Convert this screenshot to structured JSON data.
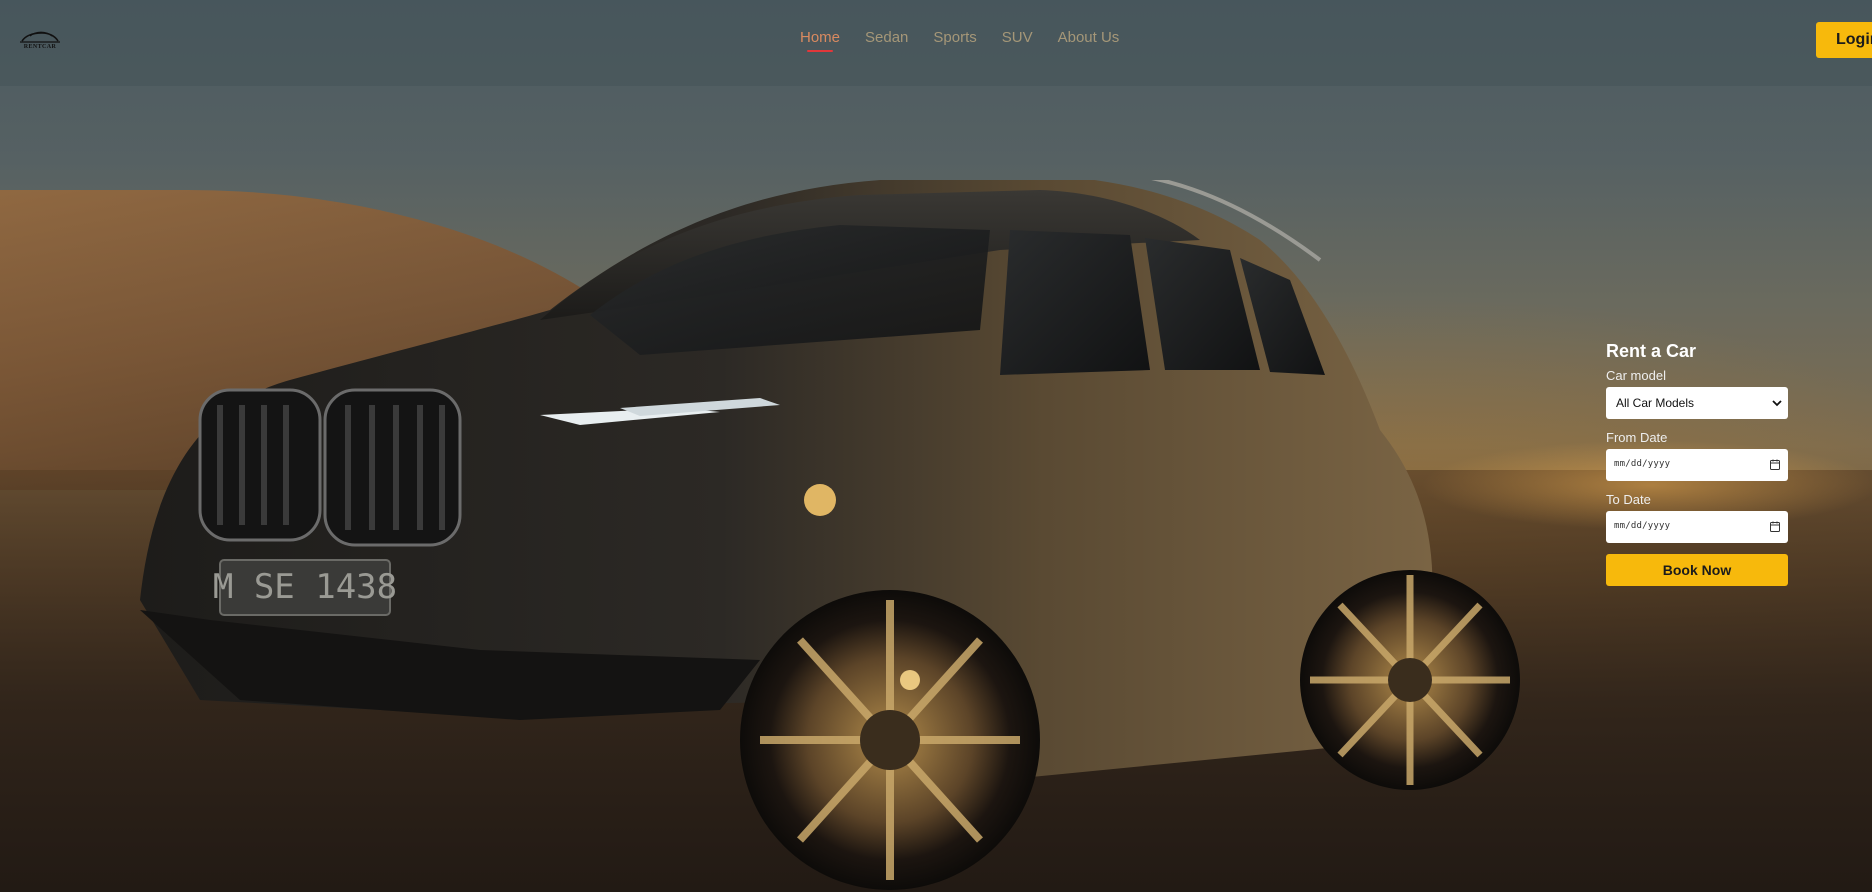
{
  "brand": {
    "logo_text": "RENTCAR"
  },
  "nav": {
    "items": [
      {
        "label": "Home",
        "active": true
      },
      {
        "label": "Sedan",
        "active": false
      },
      {
        "label": "Sports",
        "active": false
      },
      {
        "label": "SUV",
        "active": false
      },
      {
        "label": "About Us",
        "active": false
      }
    ]
  },
  "header": {
    "login_label": "Login"
  },
  "hero": {
    "plate_text": "M SE 1438"
  },
  "booking": {
    "title": "Rent a Car",
    "car_model_label": "Car model",
    "car_model_value": "All Car Models",
    "from_date_label": "From Date",
    "from_date_placeholder": "mm/dd/yyyy",
    "to_date_label": "To Date",
    "to_date_placeholder": "mm/dd/yyyy",
    "submit_label": "Book Now"
  },
  "colors": {
    "accent": "#f7b90c",
    "nav_link": "#a59778",
    "nav_active": "#d98a60",
    "nav_underline": "#e2373a"
  },
  "icons": {
    "logo": "car-logo-icon",
    "select_chevron": "chevron-down-icon",
    "date_picker": "calendar-icon"
  }
}
